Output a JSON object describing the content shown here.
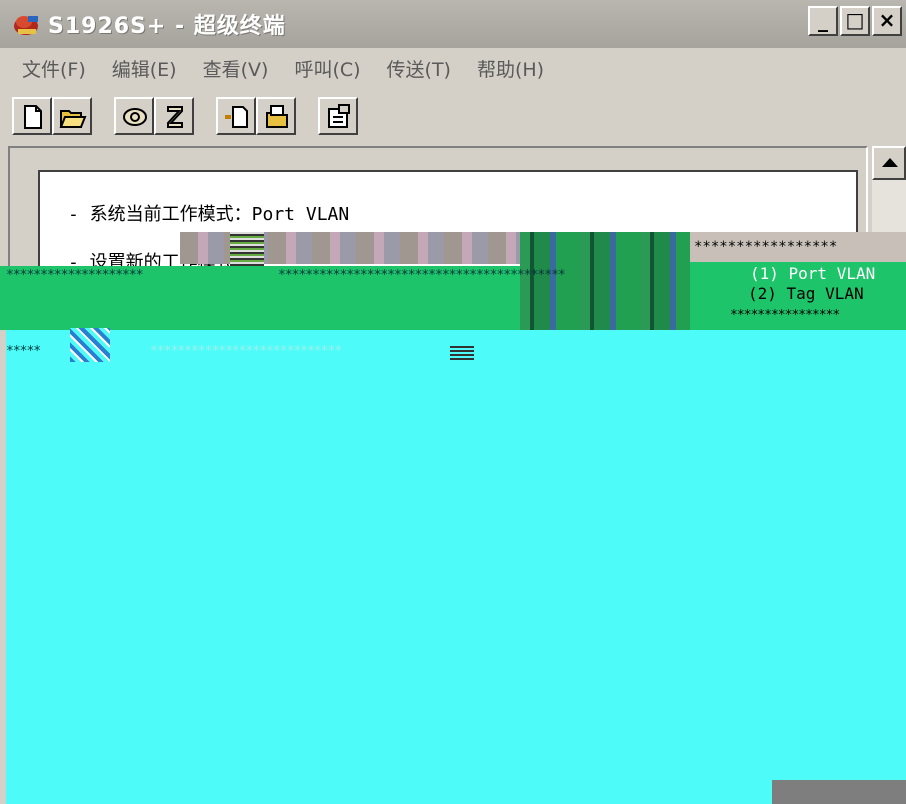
{
  "window": {
    "title": "S1926S+ - 超级终端",
    "minimize": "_",
    "maximize": "□",
    "close": "×"
  },
  "menu": [
    {
      "label": "文件(F)"
    },
    {
      "label": "编辑(E)"
    },
    {
      "label": "查看(V)"
    },
    {
      "label": "呼叫(C)"
    },
    {
      "label": "传送(T)"
    },
    {
      "label": "帮助(H)"
    }
  ],
  "toolbar_icons": [
    "new-file-icon",
    "open-folder-icon",
    "phone-connect-icon",
    "phone-disconnect-icon",
    "send-file-icon",
    "receive-file-icon",
    "properties-icon"
  ],
  "terminal": {
    "line1": "- 系统当前工作模式：Port VLAN",
    "line2": "- 设置新的工作模式：",
    "stars_short": "********************",
    "stars_long": "******************************************",
    "stars_right": "*****************",
    "option1": "(1) Port VLAN",
    "option2": "(2) Tag VLAN",
    "option_stars": "****************",
    "stars_row2a": "*****",
    "stars_row2b": "****************************"
  },
  "colors": {
    "terminal_bg": "#4dfcf8",
    "band": "#1ec46a",
    "chrome": "#d4d0c8"
  }
}
